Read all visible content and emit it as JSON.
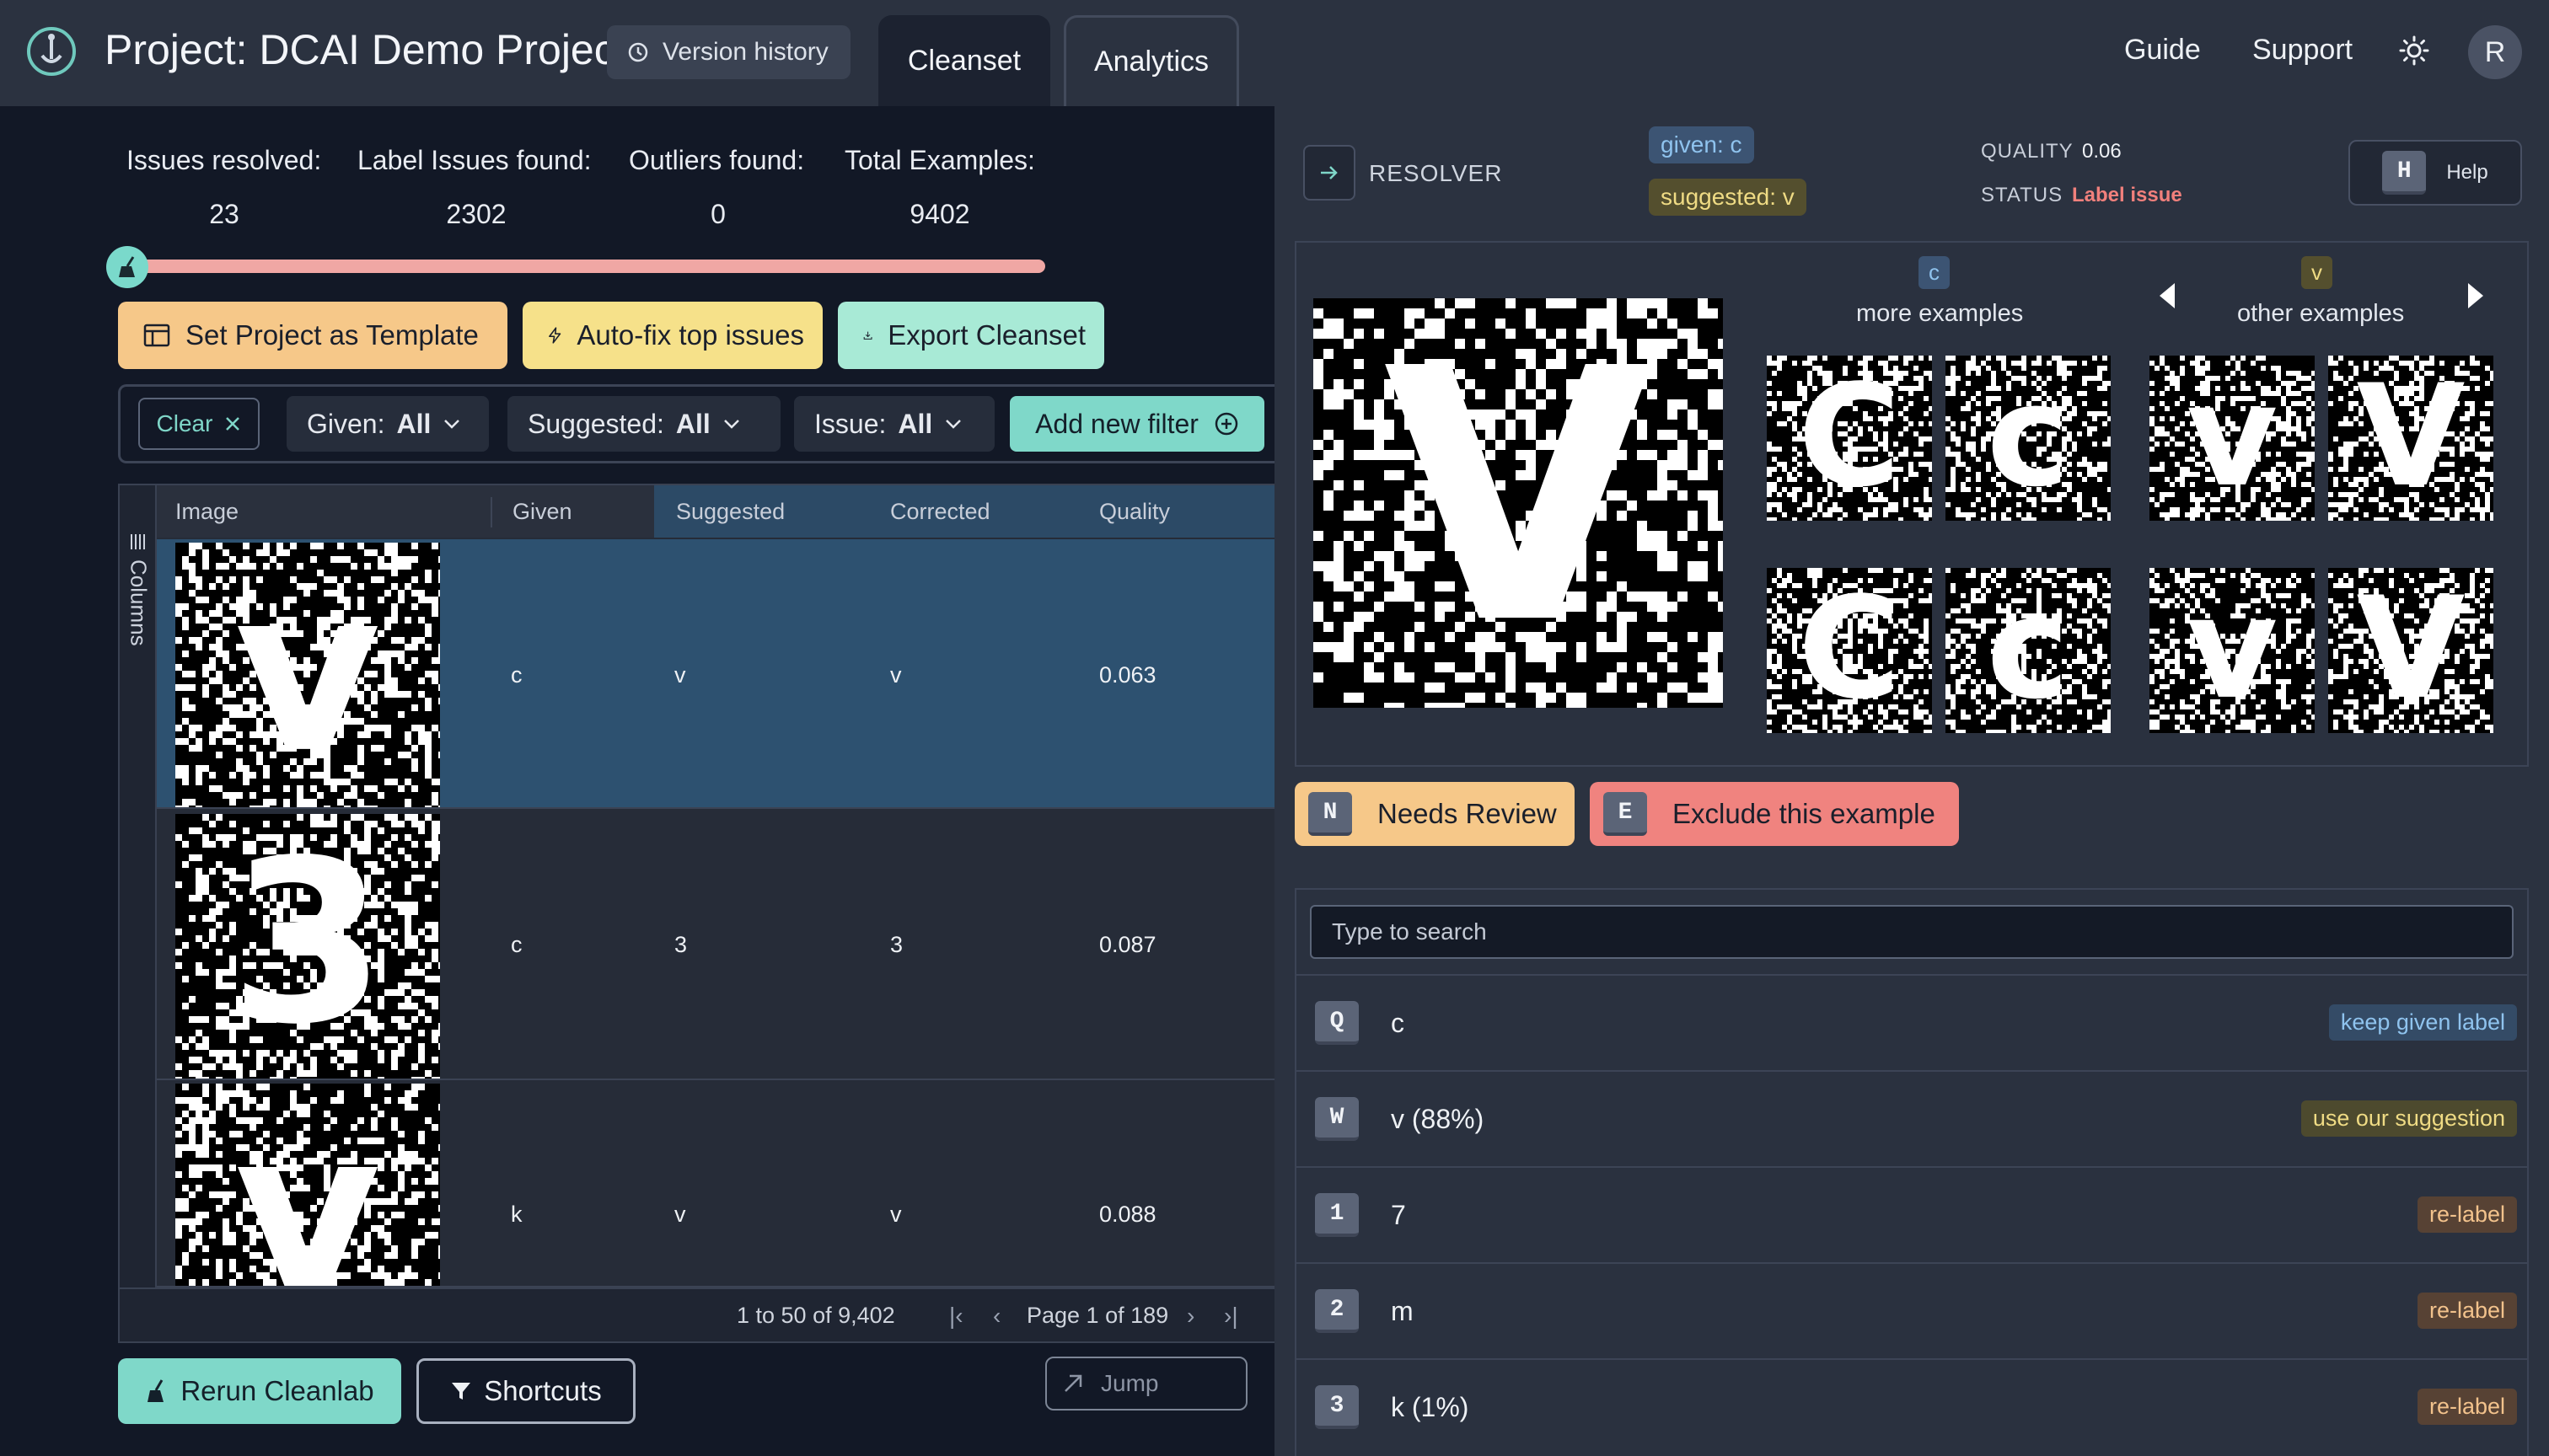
{
  "header": {
    "project_title": "Project: DCAI Demo Project",
    "version_history": "Version history",
    "tabs": [
      {
        "label": "Cleanset",
        "active": true
      },
      {
        "label": "Analytics",
        "active": false
      }
    ],
    "nav": {
      "guide": "Guide",
      "support": "Support"
    },
    "avatar_initial": "R",
    "theme_icon": "sun-icon"
  },
  "stats": {
    "issues_resolved": {
      "label": "Issues resolved:",
      "value": "23"
    },
    "label_issues": {
      "label": "Label Issues found:",
      "value": "2302"
    },
    "outliers": {
      "label": "Outliers found:",
      "value": "0"
    },
    "total": {
      "label": "Total Examples:",
      "value": "9402"
    },
    "progress_fraction": 0.01
  },
  "actions": {
    "set_template": "Set Project as Template",
    "auto_fix": "Auto-fix top issues",
    "export": "Export Cleanset"
  },
  "filters": {
    "clear": "Clear",
    "given": {
      "label": "Given:",
      "value": "All"
    },
    "suggested": {
      "label": "Suggested:",
      "value": "All"
    },
    "issue": {
      "label": "Issue:",
      "value": "All"
    },
    "add_new": "Add new filter"
  },
  "table": {
    "columns_label": "Columns",
    "headers": [
      "Image",
      "Given",
      "Suggested",
      "Corrected",
      "Quality"
    ],
    "rows": [
      {
        "image": "v",
        "given": "c",
        "suggested": "v",
        "corrected": "v",
        "quality": "0.063",
        "selected": true
      },
      {
        "image": "3",
        "given": "c",
        "suggested": "3",
        "corrected": "3",
        "quality": "0.087",
        "selected": false
      },
      {
        "image": "v",
        "given": "k",
        "suggested": "v",
        "corrected": "v",
        "quality": "0.088",
        "selected": false
      }
    ],
    "pagination": {
      "range": "1 to 50 of 9,402",
      "page": "Page 1 of 189"
    }
  },
  "footer": {
    "rerun": "Rerun Cleanlab",
    "shortcuts": "Shortcuts",
    "jump_placeholder": "Jump"
  },
  "resolver": {
    "title": "RESOLVER",
    "given_pill": "given: c",
    "suggested_pill": "suggested: v",
    "quality_label": "QUALITY",
    "quality_value": "0.06",
    "status_label": "STATUS",
    "status_value": "Label issue",
    "help_key": "H",
    "help_label": "Help",
    "main_glyph": "V",
    "more_examples": {
      "class": "c",
      "label": "more examples",
      "glyphs": [
        "C",
        "c",
        "C",
        "c"
      ]
    },
    "other_examples": {
      "class": "v",
      "label": "other examples",
      "glyphs": [
        "v",
        "V",
        "v",
        "V"
      ]
    },
    "needs_review": {
      "key": "N",
      "label": "Needs Review"
    },
    "exclude": {
      "key": "E",
      "label": "Exclude this example"
    },
    "search_placeholder": "Type to search",
    "options": [
      {
        "key": "Q",
        "label": "c",
        "tag": "keep given label",
        "kind": "keep"
      },
      {
        "key": "W",
        "label": "v  (88%)",
        "tag": "use our suggestion",
        "kind": "use"
      },
      {
        "key": "1",
        "label": "7",
        "tag": "re-label",
        "kind": "relabel"
      },
      {
        "key": "2",
        "label": "m",
        "tag": "re-label",
        "kind": "relabel"
      },
      {
        "key": "3",
        "label": "k  (1%)",
        "tag": "re-label",
        "kind": "relabel"
      }
    ]
  },
  "colors": {
    "accent_teal": "#7fd8c9",
    "warning_orange": "#f6c889",
    "danger_red": "#f0837f",
    "selected_row": "#2d5170"
  }
}
